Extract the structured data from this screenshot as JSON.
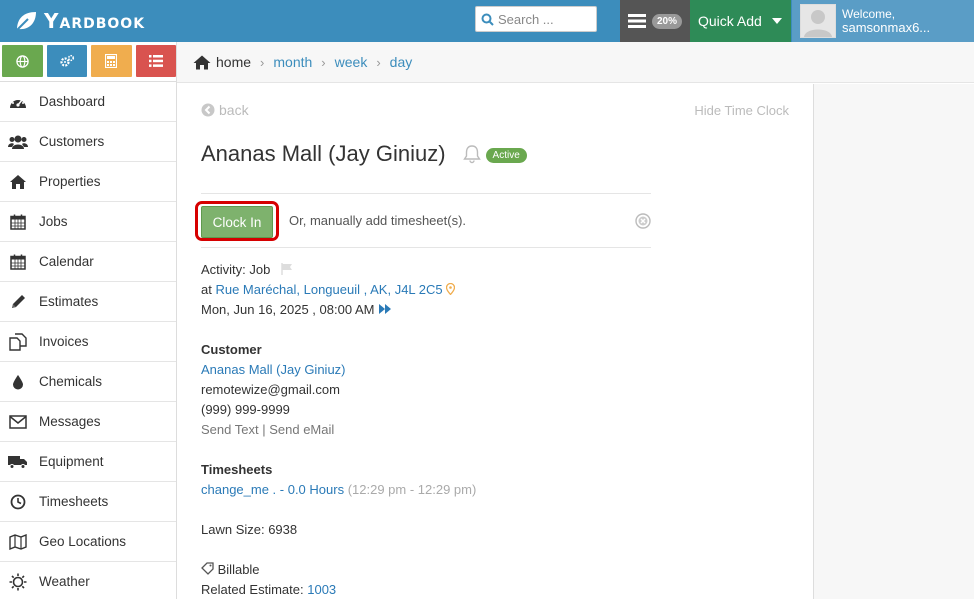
{
  "brand": {
    "name": "Yardbook"
  },
  "search": {
    "placeholder": "Search ..."
  },
  "header": {
    "progress_pct": "20%",
    "quick_add": "Quick Add",
    "welcome": "Welcome,",
    "username": "samsonmax6..."
  },
  "sidebar": {
    "top_buttons": [
      {
        "icon": "globe-icon",
        "color": "#6aa84f"
      },
      {
        "icon": "gears-icon",
        "color": "#3c8dbc"
      },
      {
        "icon": "calculator-icon",
        "color": "#f0ad4e"
      },
      {
        "icon": "list-icon",
        "color": "#d9534f"
      }
    ],
    "items": [
      {
        "label": "Dashboard",
        "icon": "dashboard-icon"
      },
      {
        "label": "Customers",
        "icon": "users-icon"
      },
      {
        "label": "Properties",
        "icon": "home-icon"
      },
      {
        "label": "Jobs",
        "icon": "calendar-icon"
      },
      {
        "label": "Calendar",
        "icon": "calendar-icon"
      },
      {
        "label": "Estimates",
        "icon": "pencil-icon"
      },
      {
        "label": "Invoices",
        "icon": "copy-icon"
      },
      {
        "label": "Chemicals",
        "icon": "drop-icon"
      },
      {
        "label": "Messages",
        "icon": "envelope-icon"
      },
      {
        "label": "Equipment",
        "icon": "truck-icon"
      },
      {
        "label": "Timesheets",
        "icon": "clock-icon"
      },
      {
        "label": "Geo Locations",
        "icon": "map-icon"
      },
      {
        "label": "Weather",
        "icon": "sun-icon"
      }
    ]
  },
  "breadcrumb": {
    "home": "home",
    "month": "month",
    "week": "week",
    "day": "day"
  },
  "main": {
    "back": "back",
    "hide_time_clock": "Hide Time Clock",
    "title": "Ananas Mall (Jay Giniuz)",
    "status": "Active",
    "clock_in": "Clock In",
    "manual_text": "Or, manually add timesheet(s).",
    "activity": "Activity: Job",
    "at_prefix": "at",
    "address": "Rue Maréchal, Longueuil , AK, J4L 2C5",
    "datetime": "Mon, Jun 16, 2025 , 08:00 AM",
    "customer_heading": "Customer",
    "customer_name": "Ananas Mall (Jay Giniuz)",
    "email": "remotewize@gmail.com",
    "phone": "(999) 999-9999",
    "send_text": "Send Text",
    "send_sep": "|",
    "send_email": "Send eMail",
    "timesheets_heading": "Timesheets",
    "timesheet_entry": "change_me . - 0.0 Hours",
    "timesheet_time": "(12:29 pm - 12:29 pm)",
    "lawn_size": "Lawn Size: 6938",
    "billable": "Billable",
    "related_estimate_label": "Related Estimate:",
    "related_estimate_num": "1003"
  }
}
